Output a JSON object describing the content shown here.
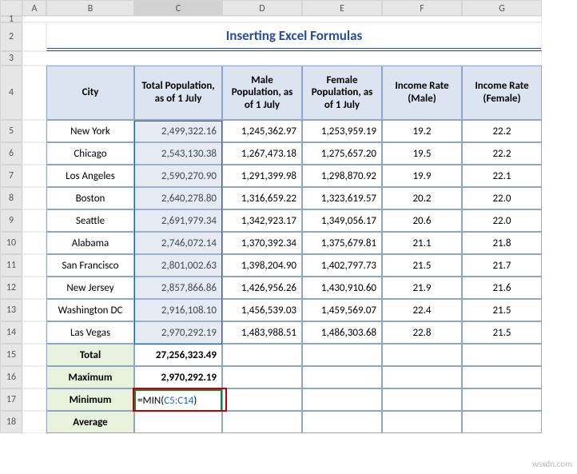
{
  "columns": [
    "A",
    "B",
    "C",
    "D",
    "E",
    "F",
    "G"
  ],
  "title": "Inserting Excel Formulas",
  "headers": {
    "city": "City",
    "total": "Total Population, as of 1 July",
    "male": "Male Population, as of 1 July",
    "female": "Female Population, as of 1 July",
    "rate_m": "Income Rate (Male)",
    "rate_f": "Income Rate (Female)"
  },
  "rows": [
    {
      "n": 5,
      "city": "New York",
      "total": "2,499,322.16",
      "male": "1,245,362.97",
      "female": "1,253,959.19",
      "rm": "19.2",
      "rf": "22.2"
    },
    {
      "n": 6,
      "city": "Chicago",
      "total": "2,543,130.38",
      "male": "1,267,473.18",
      "female": "1,275,657.20",
      "rm": "19.5",
      "rf": "22.2"
    },
    {
      "n": 7,
      "city": "Los Angeles",
      "total": "2,590,270.90",
      "male": "1,291,399.98",
      "female": "1,298,870.92",
      "rm": "19.9",
      "rf": "22.1"
    },
    {
      "n": 8,
      "city": "Boston",
      "total": "2,640,278.80",
      "male": "1,316,659.22",
      "female": "1,323,619.57",
      "rm": "20.2",
      "rf": "22.0"
    },
    {
      "n": 9,
      "city": "Seattle",
      "total": "2,691,979.34",
      "male": "1,342,923.17",
      "female": "1,349,056.17",
      "rm": "20.6",
      "rf": "22.0"
    },
    {
      "n": 10,
      "city": "Alabama",
      "total": "2,746,072.14",
      "male": "1,370,392.34",
      "female": "1,375,679.81",
      "rm": "21.1",
      "rf": "21.8"
    },
    {
      "n": 11,
      "city": "San Francisco",
      "total": "2,801,002.63",
      "male": "1,398,204.90",
      "female": "1,402,797.73",
      "rm": "21.5",
      "rf": "21.7"
    },
    {
      "n": 12,
      "city": "New Jersey",
      "total": "2,857,866.86",
      "male": "1,426,956.26",
      "female": "1,430,910.60",
      "rm": "21.9",
      "rf": "21.6"
    },
    {
      "n": 13,
      "city": "Washington DC",
      "total": "2,916,108.10",
      "male": "1,456,539.03",
      "female": "1,459,569.07",
      "rm": "22.4",
      "rf": "21.5"
    },
    {
      "n": 14,
      "city": "Las Vegas",
      "total": "2,970,292.19",
      "male": "1,483,988.51",
      "female": "1,486,303.68",
      "rm": "22.8",
      "rf": "21.5"
    }
  ],
  "summary": [
    {
      "n": 15,
      "label": "Total",
      "val": "27,256,323.49"
    },
    {
      "n": 16,
      "label": "Maximum",
      "val": "2,970,292.19"
    },
    {
      "n": 17,
      "label": "Minimum",
      "val": ""
    },
    {
      "n": 18,
      "label": "Average",
      "val": ""
    }
  ],
  "formula": {
    "prefix": "=MIN(",
    "ref": "C5:C14",
    "suffix": ")"
  },
  "watermark": "wsxdn.com",
  "active_column": "C"
}
